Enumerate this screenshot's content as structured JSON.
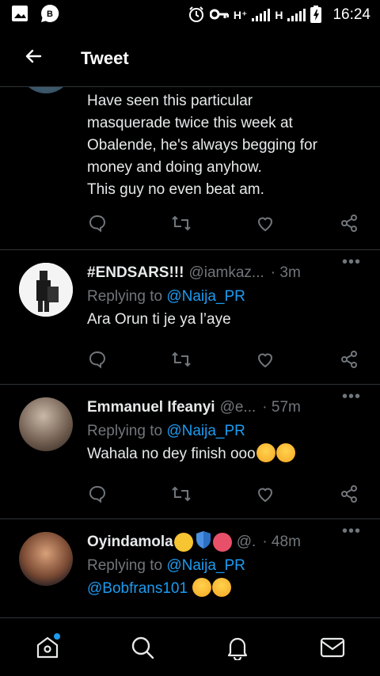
{
  "status_bar": {
    "network_1": "H⁺",
    "network_2": "H",
    "time": "16:24"
  },
  "header": {
    "title": "Tweet",
    "back_icon": "arrow-left-icon"
  },
  "parent_tweet": {
    "body_lines": [
      "Have seen this particular",
      "masquerade twice this week at",
      "Obalende, he's always begging for",
      "money and doing anyhow.",
      "This guy no even beat am."
    ]
  },
  "replies": [
    {
      "name": "#ENDSARS!!!",
      "handle": "@iamkaz...",
      "time": "· 3m",
      "replying_prefix": "Replying to",
      "replying_to": "@Naija_PR",
      "body": "Ara Orun ti je ya l’aye"
    },
    {
      "name": "Emmanuel Ifeanyi",
      "handle": "@e...",
      "time": "· 57m",
      "replying_prefix": "Replying to",
      "replying_to": "@Naija_PR",
      "body": "Wahala no dey finish ooo"
    },
    {
      "name": "Oyindamola",
      "handle": "@.",
      "time": "· 48m",
      "replying_prefix": "Replying to",
      "replying_to": "@Naija_PR",
      "body": "@Bobfrans101"
    }
  ],
  "more_label": "•••",
  "colors": {
    "background": "#000000",
    "text": "#e7e9ea",
    "muted": "#71767b",
    "accent": "#1d9bf0",
    "divider": "#2f3336"
  },
  "bottom_nav": [
    "home-icon",
    "search-icon",
    "notifications-icon",
    "messages-icon"
  ]
}
